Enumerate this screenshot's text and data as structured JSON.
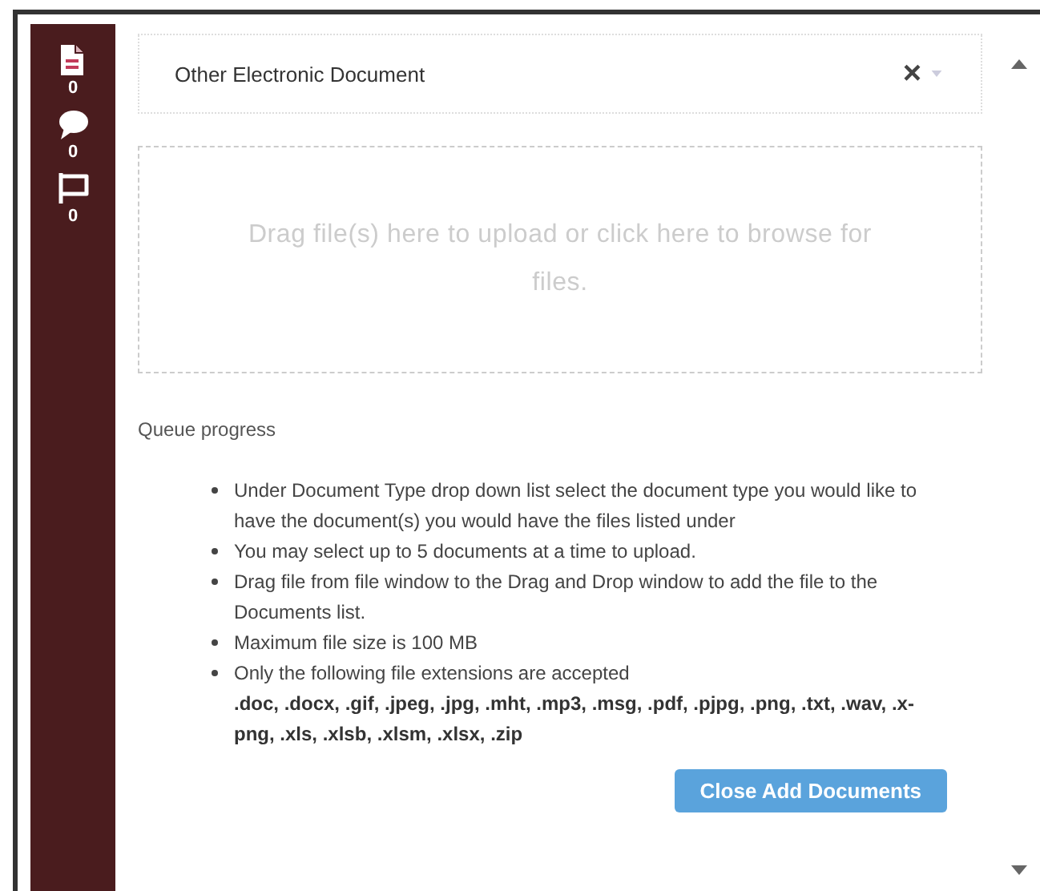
{
  "sidebar": {
    "items": [
      {
        "kind": "document",
        "count": "0"
      },
      {
        "kind": "comment",
        "count": "0"
      },
      {
        "kind": "flag",
        "count": "0"
      }
    ]
  },
  "document_type": {
    "value": "Other Electronic Document",
    "clear": "×"
  },
  "dropzone": {
    "text": "Drag file(s) here to upload or click here to browse for files."
  },
  "queue_label": "Queue progress",
  "instructions": [
    {
      "text": "Under Document Type drop down list select the document type you would like to have the document(s) you would have the files listed under"
    },
    {
      "text": "You may select up to 5 documents at a time to upload."
    },
    {
      "text": "Drag file from file window to the Drag and Drop window to add the file to the Documents list."
    },
    {
      "text": "Maximum file size is 100 MB"
    },
    {
      "text": "Only the following file extensions are accepted",
      "detail": ".doc, .docx, .gif, .jpeg, .jpg, .mht, .mp3, .msg, .pdf, .pjpg, .png, .txt, .wav, .x-png, .xls, .xlsb, .xlsm, .xlsx, .zip"
    }
  ],
  "buttons": [
    {
      "label": "Close Add Documents"
    }
  ]
}
